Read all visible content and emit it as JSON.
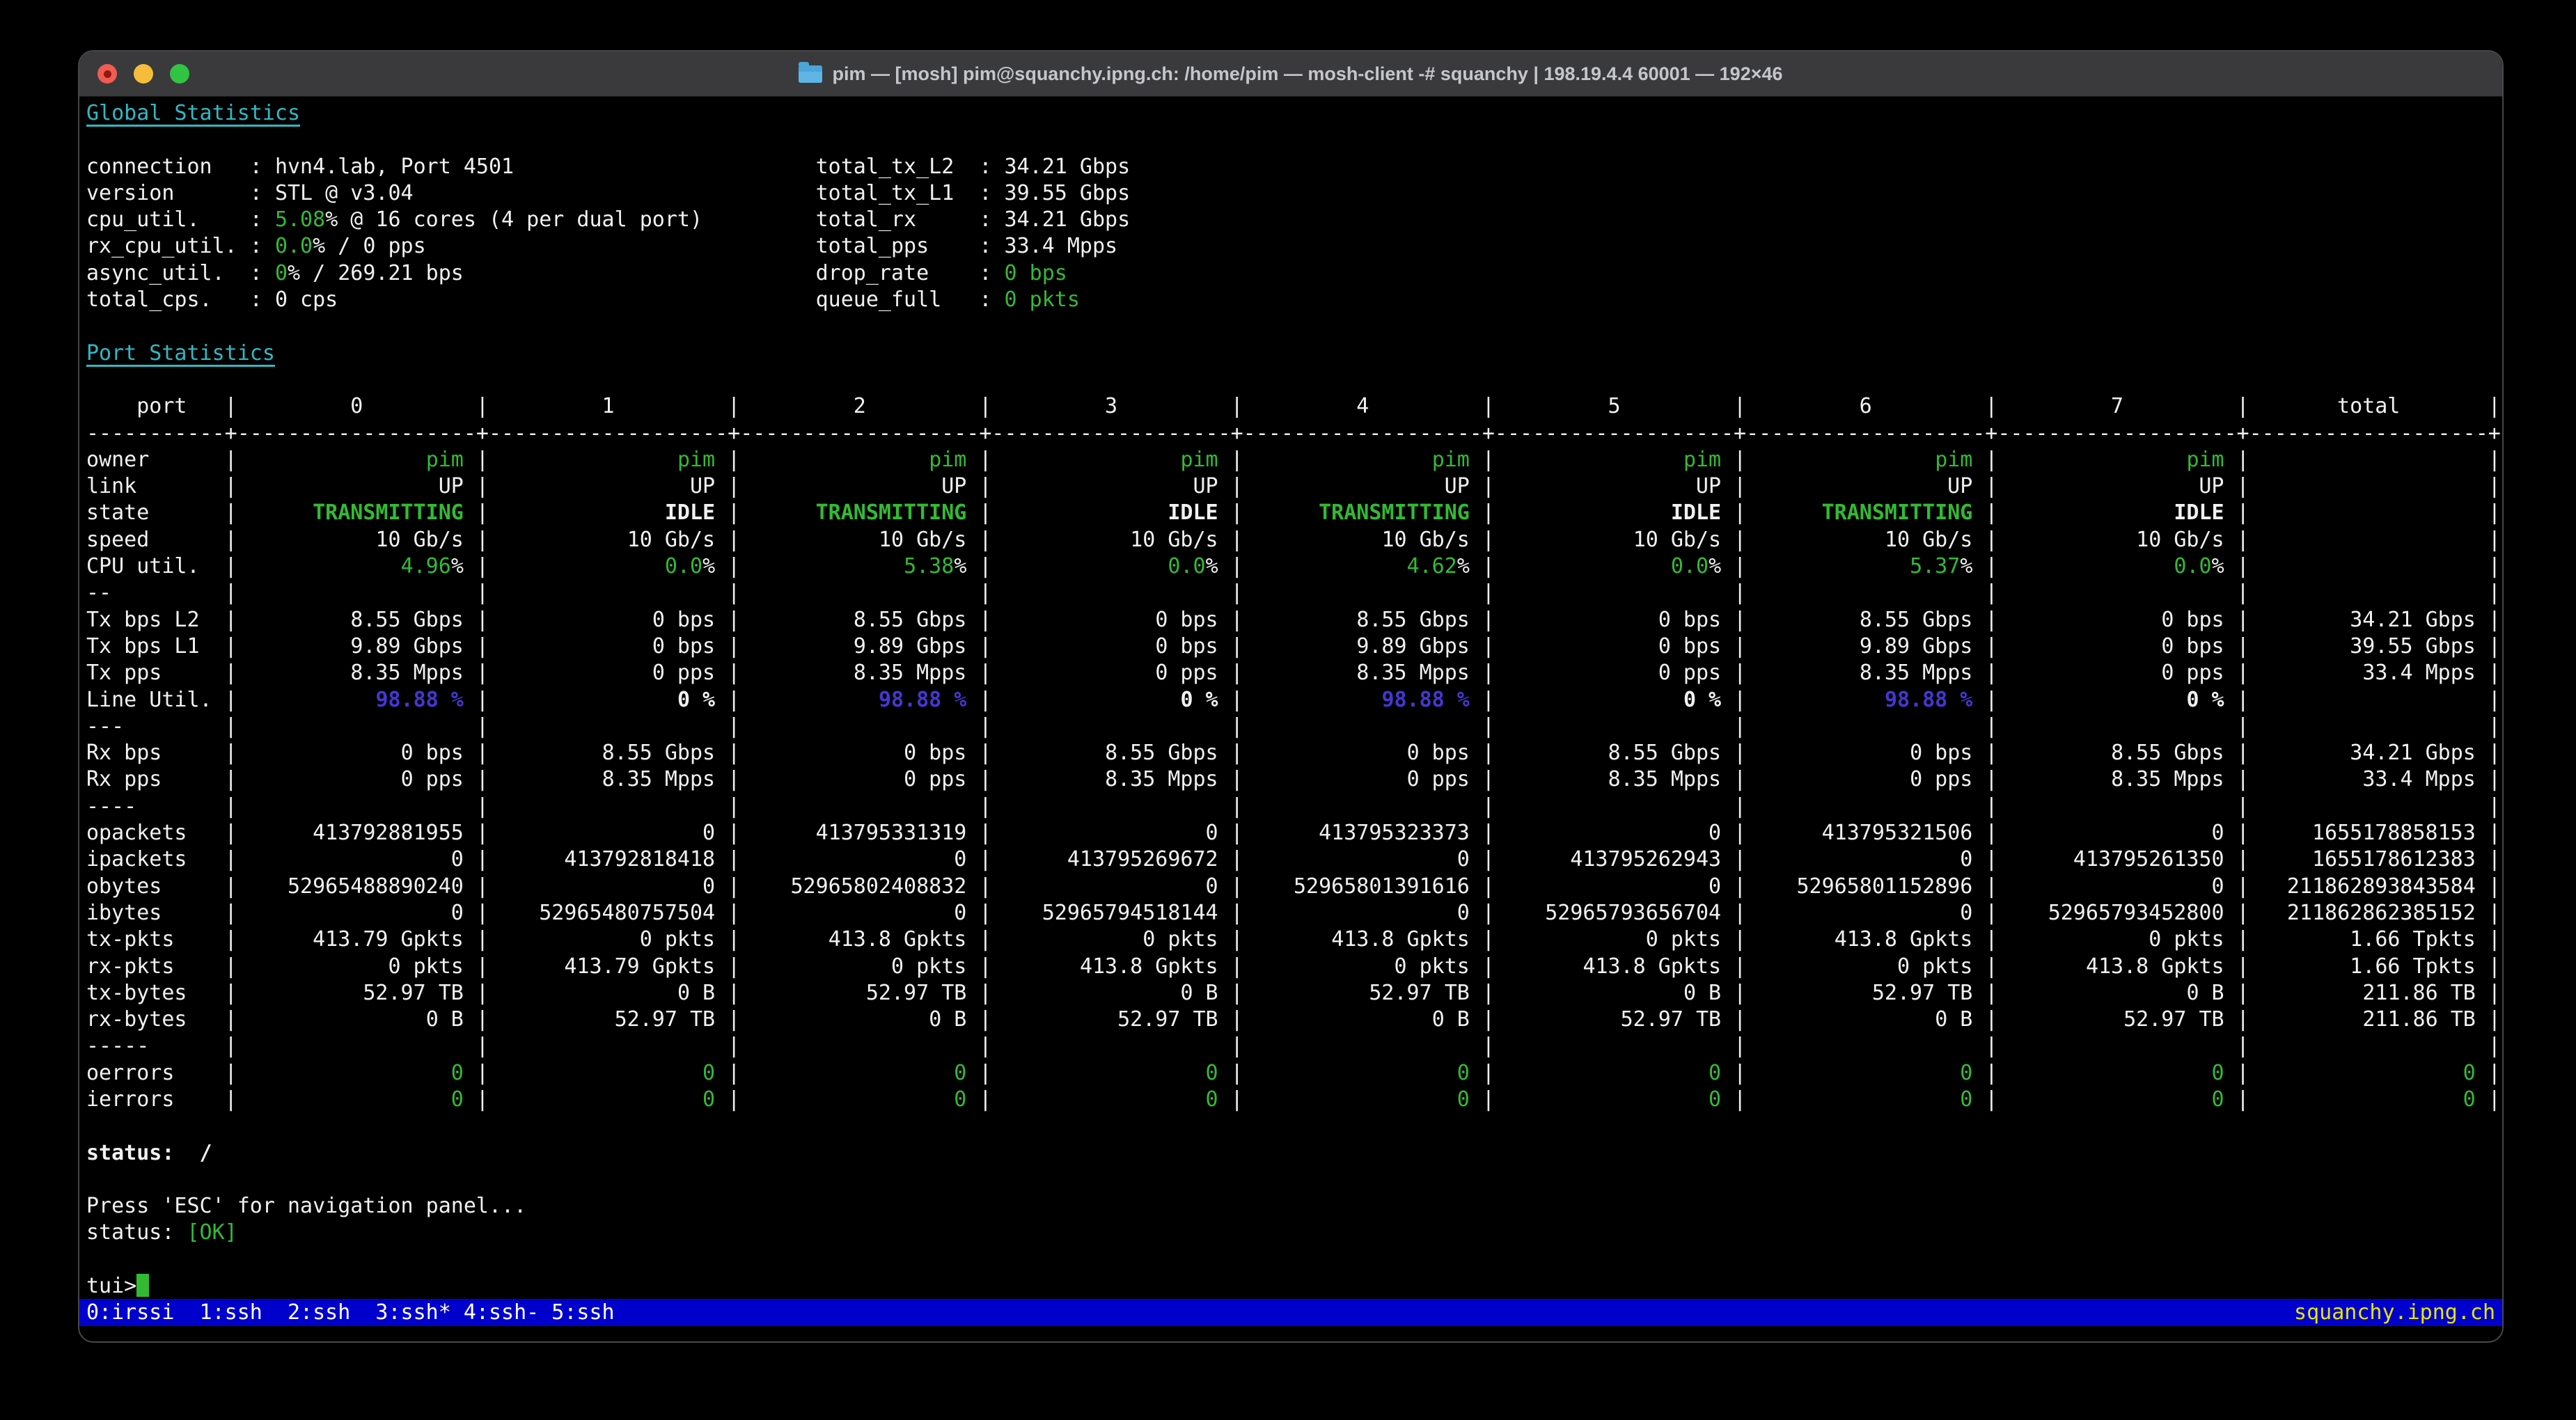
{
  "window": {
    "title": "pim — [mosh] pim@squanchy.ipng.ch: /home/pim — mosh-client -# squanchy | 198.19.4.4 60001 — 192×46",
    "buttons": {
      "close": "close-button",
      "minimize": "minimize-button",
      "zoom": "zoom-button"
    },
    "icon": "folder-icon"
  },
  "colors": {
    "green": "#32bb32",
    "cyan": "#2fb9c5",
    "line_util_blue": "#4636d2",
    "tmux_bar_blue": "#0000cc",
    "hostname_yellow": "#e6e600",
    "titlebar_gray": "#3a3a3c",
    "terminal_bg": "#000000",
    "terminal_fg": "#f1f1f1"
  },
  "global_stats": {
    "heading": "Global Statistics",
    "rows": [
      {
        "left_label": "connection",
        "left": [
          [
            "hvn4.lab, Port 4501",
            ""
          ]
        ],
        "right_label": "total_tx_L2",
        "right": [
          [
            "34.21 Gbps",
            ""
          ]
        ]
      },
      {
        "left_label": "version",
        "left": [
          [
            "STL @ v3.04",
            ""
          ]
        ],
        "right_label": "total_tx_L1",
        "right": [
          [
            "39.55 Gbps",
            ""
          ]
        ]
      },
      {
        "left_label": "cpu_util.",
        "left": [
          [
            "5.08",
            "g"
          ],
          [
            "% @ 16 cores (4 per dual port)",
            ""
          ]
        ],
        "right_label": "total_rx",
        "right": [
          [
            "34.21 Gbps",
            ""
          ]
        ]
      },
      {
        "left_label": "rx_cpu_util.",
        "left": [
          [
            "0.0",
            "g"
          ],
          [
            "% / 0 pps",
            ""
          ]
        ],
        "right_label": "total_pps",
        "right": [
          [
            "33.4 Mpps",
            ""
          ]
        ]
      },
      {
        "left_label": "async_util.",
        "left": [
          [
            "0",
            "g"
          ],
          [
            "% / 269.21 bps",
            ""
          ]
        ],
        "right_label": "drop_rate",
        "right": [
          [
            "0 bps",
            "g"
          ]
        ]
      },
      {
        "left_label": "total_cps.",
        "left": [
          [
            "0 cps",
            ""
          ]
        ],
        "right_label": "queue_full",
        "right": [
          [
            "0 pkts",
            "g"
          ]
        ]
      }
    ]
  },
  "port_stats": {
    "heading": "Port Statistics",
    "port_label": "port",
    "columns": [
      "0",
      "1",
      "2",
      "3",
      "4",
      "5",
      "6",
      "7",
      "total"
    ],
    "rows": [
      {
        "label": "owner",
        "cells": [
          [
            "pim",
            "g"
          ],
          [
            "pim",
            "g"
          ],
          [
            "pim",
            "g"
          ],
          [
            "pim",
            "g"
          ],
          [
            "pim",
            "g"
          ],
          [
            "pim",
            "g"
          ],
          [
            "pim",
            "g"
          ],
          [
            "pim",
            "g"
          ],
          [
            "",
            ""
          ]
        ]
      },
      {
        "label": "link",
        "cells": [
          [
            "UP"
          ],
          [
            "UP"
          ],
          [
            "UP"
          ],
          [
            "UP"
          ],
          [
            "UP"
          ],
          [
            "UP"
          ],
          [
            "UP"
          ],
          [
            "UP"
          ],
          [
            "",
            ""
          ]
        ]
      },
      {
        "label": "state",
        "cells": [
          [
            "TRANSMITTING",
            "g",
            1
          ],
          [
            "IDLE",
            "",
            1
          ],
          [
            "TRANSMITTING",
            "g",
            1
          ],
          [
            "IDLE",
            "",
            1
          ],
          [
            "TRANSMITTING",
            "g",
            1
          ],
          [
            "IDLE",
            "",
            1
          ],
          [
            "TRANSMITTING",
            "g",
            1
          ],
          [
            "IDLE",
            "",
            1
          ],
          [
            "",
            ""
          ]
        ]
      },
      {
        "label": "speed",
        "cells": [
          [
            "10 Gb/s"
          ],
          [
            "10 Gb/s"
          ],
          [
            "10 Gb/s"
          ],
          [
            "10 Gb/s"
          ],
          [
            "10 Gb/s"
          ],
          [
            "10 Gb/s"
          ],
          [
            "10 Gb/s"
          ],
          [
            "10 Gb/s"
          ],
          [
            "",
            ""
          ]
        ]
      },
      {
        "label": "CPU util.",
        "cells": [
          [
            "4.96",
            "g",
            0,
            "%"
          ],
          [
            "0.0",
            "g",
            0,
            "%"
          ],
          [
            "5.38",
            "g",
            0,
            "%"
          ],
          [
            "0.0",
            "g",
            0,
            "%"
          ],
          [
            "4.62",
            "g",
            0,
            "%"
          ],
          [
            "0.0",
            "g",
            0,
            "%"
          ],
          [
            "5.37",
            "g",
            0,
            "%"
          ],
          [
            "0.0",
            "g",
            0,
            "%"
          ],
          [
            "",
            ""
          ]
        ]
      },
      {
        "label": "--",
        "cells": []
      },
      {
        "label": "Tx bps L2",
        "cells": [
          [
            "8.55 Gbps"
          ],
          [
            "0 bps"
          ],
          [
            "8.55 Gbps"
          ],
          [
            "0 bps"
          ],
          [
            "8.55 Gbps"
          ],
          [
            "0 bps"
          ],
          [
            "8.55 Gbps"
          ],
          [
            "0 bps"
          ],
          [
            "34.21 Gbps"
          ]
        ]
      },
      {
        "label": "Tx bps L1",
        "cells": [
          [
            "9.89 Gbps"
          ],
          [
            "0 bps"
          ],
          [
            "9.89 Gbps"
          ],
          [
            "0 bps"
          ],
          [
            "9.89 Gbps"
          ],
          [
            "0 bps"
          ],
          [
            "9.89 Gbps"
          ],
          [
            "0 bps"
          ],
          [
            "39.55 Gbps"
          ]
        ]
      },
      {
        "label": "Tx pps",
        "cells": [
          [
            "8.35 Mpps"
          ],
          [
            "0 pps"
          ],
          [
            "8.35 Mpps"
          ],
          [
            "0 pps"
          ],
          [
            "8.35 Mpps"
          ],
          [
            "0 pps"
          ],
          [
            "8.35 Mpps"
          ],
          [
            "0 pps"
          ],
          [
            "33.4 Mpps"
          ]
        ]
      },
      {
        "label": "Line Util.",
        "cells": [
          [
            "98.88 %",
            "bl",
            1
          ],
          [
            "0 %",
            "",
            1
          ],
          [
            "98.88 %",
            "bl",
            1
          ],
          [
            "0 %",
            "",
            1
          ],
          [
            "98.88 %",
            "bl",
            1
          ],
          [
            "0 %",
            "",
            1
          ],
          [
            "98.88 %",
            "bl",
            1
          ],
          [
            "0 %",
            "",
            1
          ],
          [
            "",
            ""
          ]
        ]
      },
      {
        "label": "---",
        "cells": []
      },
      {
        "label": "Rx bps",
        "cells": [
          [
            "0 bps"
          ],
          [
            "8.55 Gbps"
          ],
          [
            "0 bps"
          ],
          [
            "8.55 Gbps"
          ],
          [
            "0 bps"
          ],
          [
            "8.55 Gbps"
          ],
          [
            "0 bps"
          ],
          [
            "8.55 Gbps"
          ],
          [
            "34.21 Gbps"
          ]
        ]
      },
      {
        "label": "Rx pps",
        "cells": [
          [
            "0 pps"
          ],
          [
            "8.35 Mpps"
          ],
          [
            "0 pps"
          ],
          [
            "8.35 Mpps"
          ],
          [
            "0 pps"
          ],
          [
            "8.35 Mpps"
          ],
          [
            "0 pps"
          ],
          [
            "8.35 Mpps"
          ],
          [
            "33.4 Mpps"
          ]
        ]
      },
      {
        "label": "----",
        "cells": []
      },
      {
        "label": "opackets",
        "cells": [
          [
            "413792881955"
          ],
          [
            "0"
          ],
          [
            "413795331319"
          ],
          [
            "0"
          ],
          [
            "413795323373"
          ],
          [
            "0"
          ],
          [
            "413795321506"
          ],
          [
            "0"
          ],
          [
            "1655178858153"
          ]
        ]
      },
      {
        "label": "ipackets",
        "cells": [
          [
            "0"
          ],
          [
            "413792818418"
          ],
          [
            "0"
          ],
          [
            "413795269672"
          ],
          [
            "0"
          ],
          [
            "413795262943"
          ],
          [
            "0"
          ],
          [
            "413795261350"
          ],
          [
            "1655178612383"
          ]
        ]
      },
      {
        "label": "obytes",
        "cells": [
          [
            "52965488890240"
          ],
          [
            "0"
          ],
          [
            "52965802408832"
          ],
          [
            "0"
          ],
          [
            "52965801391616"
          ],
          [
            "0"
          ],
          [
            "52965801152896"
          ],
          [
            "0"
          ],
          [
            "211862893843584"
          ]
        ]
      },
      {
        "label": "ibytes",
        "cells": [
          [
            "0"
          ],
          [
            "52965480757504"
          ],
          [
            "0"
          ],
          [
            "52965794518144"
          ],
          [
            "0"
          ],
          [
            "52965793656704"
          ],
          [
            "0"
          ],
          [
            "52965793452800"
          ],
          [
            "211862862385152"
          ]
        ]
      },
      {
        "label": "tx-pkts",
        "cells": [
          [
            "413.79 Gpkts"
          ],
          [
            "0 pkts"
          ],
          [
            "413.8 Gpkts"
          ],
          [
            "0 pkts"
          ],
          [
            "413.8 Gpkts"
          ],
          [
            "0 pkts"
          ],
          [
            "413.8 Gpkts"
          ],
          [
            "0 pkts"
          ],
          [
            "1.66 Tpkts"
          ]
        ]
      },
      {
        "label": "rx-pkts",
        "cells": [
          [
            "0 pkts"
          ],
          [
            "413.79 Gpkts"
          ],
          [
            "0 pkts"
          ],
          [
            "413.8 Gpkts"
          ],
          [
            "0 pkts"
          ],
          [
            "413.8 Gpkts"
          ],
          [
            "0 pkts"
          ],
          [
            "413.8 Gpkts"
          ],
          [
            "1.66 Tpkts"
          ]
        ]
      },
      {
        "label": "tx-bytes",
        "cells": [
          [
            "52.97 TB"
          ],
          [
            "0 B"
          ],
          [
            "52.97 TB"
          ],
          [
            "0 B"
          ],
          [
            "52.97 TB"
          ],
          [
            "0 B"
          ],
          [
            "52.97 TB"
          ],
          [
            "0 B"
          ],
          [
            "211.86 TB"
          ]
        ]
      },
      {
        "label": "rx-bytes",
        "cells": [
          [
            "0 B"
          ],
          [
            "52.97 TB"
          ],
          [
            "0 B"
          ],
          [
            "52.97 TB"
          ],
          [
            "0 B"
          ],
          [
            "52.97 TB"
          ],
          [
            "0 B"
          ],
          [
            "52.97 TB"
          ],
          [
            "211.86 TB"
          ]
        ]
      },
      {
        "label": "-----",
        "cells": []
      },
      {
        "label": "oerrors",
        "cells": [
          [
            "0",
            "g"
          ],
          [
            "0",
            "g"
          ],
          [
            "0",
            "g"
          ],
          [
            "0",
            "g"
          ],
          [
            "0",
            "g"
          ],
          [
            "0",
            "g"
          ],
          [
            "0",
            "g"
          ],
          [
            "0",
            "g"
          ],
          [
            "0",
            "g"
          ]
        ]
      },
      {
        "label": "ierrors",
        "cells": [
          [
            "0",
            "g"
          ],
          [
            "0",
            "g"
          ],
          [
            "0",
            "g"
          ],
          [
            "0",
            "g"
          ],
          [
            "0",
            "g"
          ],
          [
            "0",
            "g"
          ],
          [
            "0",
            "g"
          ],
          [
            "0",
            "g"
          ],
          [
            "0",
            "g"
          ]
        ]
      }
    ]
  },
  "footer": {
    "spinner_line": "status:  /",
    "esc_hint": "Press 'ESC' for navigation panel...",
    "status_label": "status: ",
    "status_value": "[OK]",
    "prompt": "tui>"
  },
  "tmux_bar": {
    "left": "0:irssi  1:ssh  2:ssh  3:ssh* 4:ssh- 5:ssh",
    "right": "squanchy.ipng.ch"
  }
}
